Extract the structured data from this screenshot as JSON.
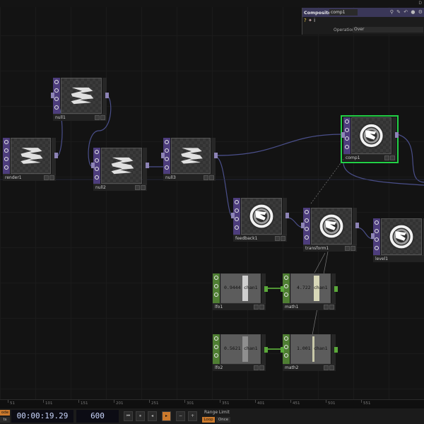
{
  "nodes": [
    {
      "id": "render1",
      "label": "render1",
      "kind": "top"
    },
    {
      "id": "null1",
      "label": "null1",
      "kind": "top"
    },
    {
      "id": "null2",
      "label": "null2",
      "kind": "top"
    },
    {
      "id": "null3",
      "label": "null3",
      "kind": "top"
    },
    {
      "id": "comp1",
      "label": "comp1",
      "kind": "top",
      "selected": true
    },
    {
      "id": "feedback1",
      "label": "feedback1",
      "kind": "top"
    },
    {
      "id": "transform1",
      "label": "transform1",
      "kind": "top"
    },
    {
      "id": "level1",
      "label": "level1",
      "kind": "top"
    },
    {
      "id": "lfo1",
      "label": "lfo1",
      "kind": "chop",
      "value": "0.9444",
      "channel": "chan1"
    },
    {
      "id": "math1",
      "label": "math1",
      "kind": "chop",
      "value": "4.722",
      "channel": "chan1"
    },
    {
      "id": "lfo2",
      "label": "lfo2",
      "kind": "chop",
      "value": "0.5621",
      "channel": "chan1"
    },
    {
      "id": "math2",
      "label": "math2",
      "kind": "chop",
      "value": "1.001",
      "channel": "chan1"
    }
  ],
  "panel": {
    "type": "Composite",
    "name": "comp1",
    "operation_label": "Operation",
    "operation_value": "Over",
    "help": "?",
    "info": "i"
  },
  "ruler": {
    "ticks": [
      "51",
      "101",
      "151",
      "201",
      "251",
      "301",
      "351",
      "401",
      "451",
      "501",
      "551"
    ]
  },
  "timebar": {
    "mode_top": "ode",
    "mode_bottom": "ts",
    "timecode": "00:00:19.29",
    "frame": "600",
    "range_label": "Range Limit",
    "loop_label": "Loop",
    "once_label": "Once"
  },
  "colors": {
    "top_strip": "#4d3d7c",
    "chop_strip": "#4f7e33",
    "selection": "#22d046",
    "wire": "#4a4f8a",
    "chop_wire": "#5aa83a",
    "play_active": "#cc7a2c"
  },
  "icons": [
    "viewer-active-icon",
    "bypass-icon",
    "display-flag-icon",
    "cook-icon",
    "help-icon",
    "info-icon",
    "play-icon",
    "pause-icon",
    "rewind-icon",
    "step-back-icon",
    "step-forward-icon"
  ]
}
